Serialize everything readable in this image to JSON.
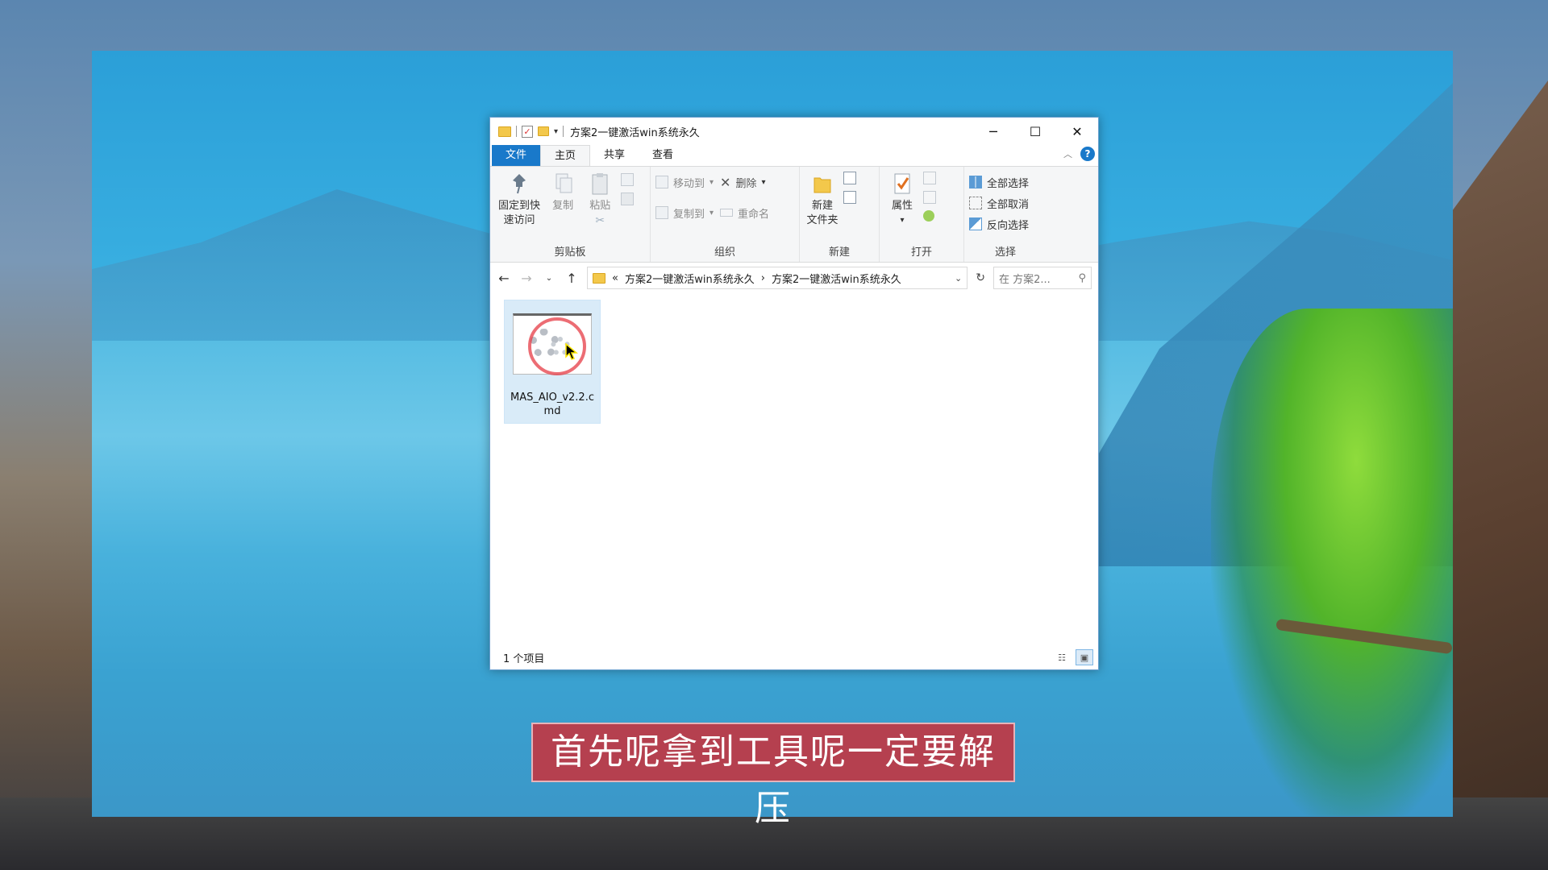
{
  "window": {
    "title": "方案2一键激活win系统永久",
    "controls": {
      "minimize": "─",
      "maximize": "☐",
      "close": "✕"
    }
  },
  "tabs": [
    {
      "label": "文件"
    },
    {
      "label": "主页"
    },
    {
      "label": "共享"
    },
    {
      "label": "查看"
    }
  ],
  "ribbon": {
    "clipboard": {
      "pin_label_1": "固定到快",
      "pin_label_2": "速访问",
      "copy": "复制",
      "paste": "粘贴",
      "group": "剪贴板"
    },
    "organize": {
      "move_to": "移动到",
      "copy_to": "复制到",
      "delete": "删除",
      "rename": "重命名",
      "group": "组织"
    },
    "new": {
      "new_folder_1": "新建",
      "new_folder_2": "文件夹",
      "group": "新建"
    },
    "open": {
      "properties": "属性",
      "group": "打开"
    },
    "select": {
      "select_all": "全部选择",
      "select_none": "全部取消",
      "invert": "反向选择",
      "group": "选择"
    }
  },
  "address": {
    "prefix": "«",
    "crumbs": [
      "方案2一键激活win系统永久",
      "方案2一键激活win系统永久"
    ],
    "separator": "›",
    "search_placeholder": "在 方案2..."
  },
  "files": [
    {
      "name": "MAS_AIO_v2.2.cmd"
    }
  ],
  "status": {
    "count": "1 个项目"
  },
  "subtitle": "首先呢拿到工具呢一定要解压",
  "colors": {
    "accent": "#1979ca",
    "subtitle_bg": "#b5404f",
    "selection": "#d9ebf8"
  }
}
